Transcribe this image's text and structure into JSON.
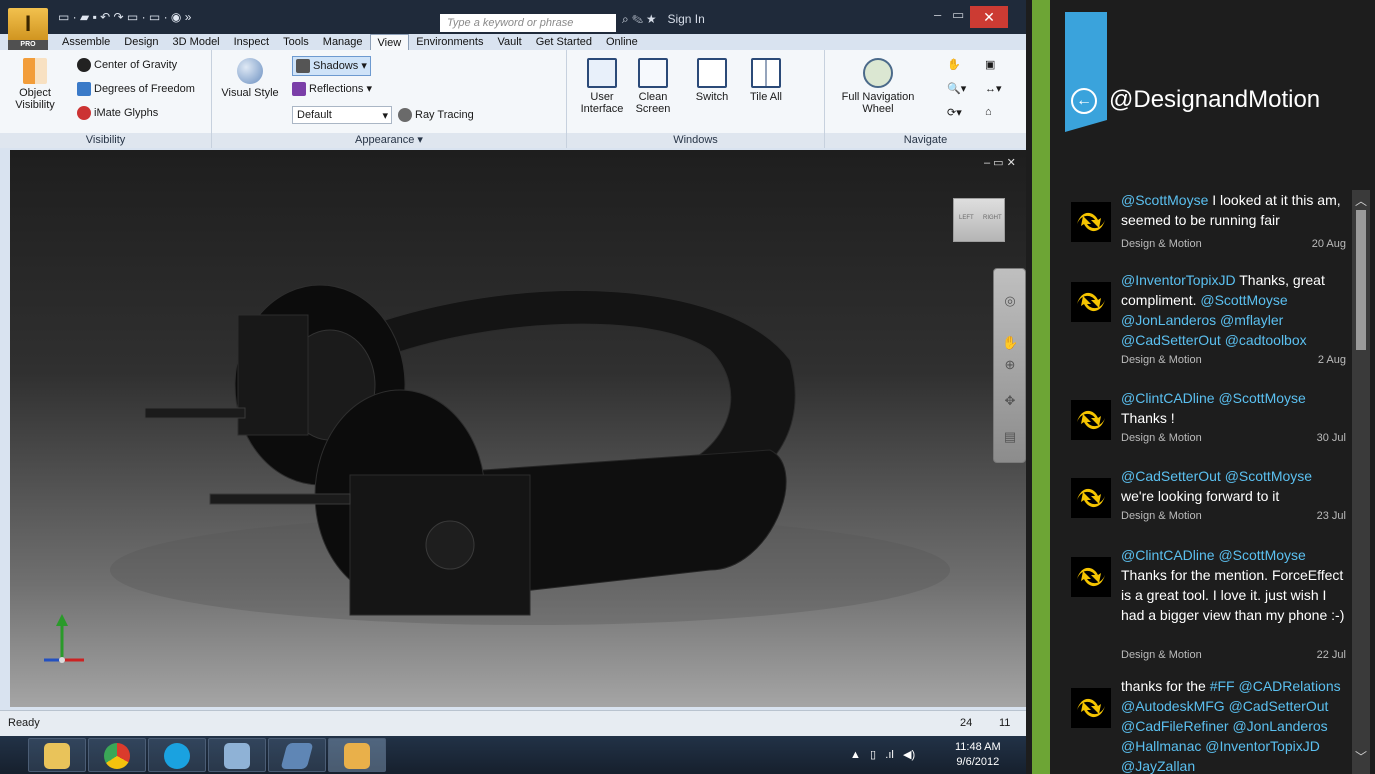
{
  "app": {
    "quick_access": "▭ · ▰ ▪ ↶ ↷ ▭ · ▭ · ◉ »",
    "search_placeholder": "Type a keyword or phrase",
    "sign_in": "Sign In",
    "tabs": [
      {
        "label": "Assemble"
      },
      {
        "label": "Design"
      },
      {
        "label": "3D Model"
      },
      {
        "label": "Inspect"
      },
      {
        "label": "Tools"
      },
      {
        "label": "Manage"
      },
      {
        "label": "View"
      },
      {
        "label": "Environments"
      },
      {
        "label": "Vault"
      },
      {
        "label": "Get Started"
      },
      {
        "label": "Online"
      }
    ],
    "active_tab": "View",
    "ribbon": {
      "visibility": {
        "object_visibility": "Object Visibility",
        "center_of_gravity": "Center of Gravity",
        "degrees_of_freedom": "Degrees of Freedom",
        "imate_glyphs": "iMate Glyphs",
        "label": "Visibility"
      },
      "appearance": {
        "visual_style": "Visual Style",
        "shadows": "Shadows",
        "reflections": "Reflections",
        "default": "Default",
        "ray_tracing": "Ray Tracing",
        "label": "Appearance ▾"
      },
      "windows": {
        "user_interface": "User Interface",
        "clean_screen": "Clean Screen",
        "switch": "Switch",
        "tile_all": "Tile All",
        "label": "Windows"
      },
      "navigate": {
        "full_nav_wheel": "Full Navigation Wheel",
        "label": "Navigate"
      }
    },
    "viewcube": {
      "left": "LEFT",
      "right": "RIGHT"
    },
    "status": {
      "text": "Ready",
      "count_a": "24",
      "count_b": "11"
    },
    "clock": {
      "time": "11:48 AM",
      "date": "9/6/2012"
    }
  },
  "sidebar": {
    "handle": "@DesignandMotion",
    "tweets": [
      {
        "mention": "@ScottMoyse",
        "body": " I looked at it this am, seemed to be running fair",
        "author": "Design & Motion",
        "date": "20 Aug"
      },
      {
        "mention": "@InventorTopixJD",
        "body": " Thanks, great compliment. ",
        "tail_mentions": "@ScottMoyse @JonLanderos @mflayler @CadSetterOut @cadtoolbox",
        "author": "Design & Motion",
        "date": "2 Aug"
      },
      {
        "mention": "@ClintCADline @ScottMoyse",
        "body": " Thanks !",
        "author": "Design & Motion",
        "date": "30 Jul"
      },
      {
        "mention": "@CadSetterOut @ScottMoyse",
        "body": " we're looking forward to it",
        "author": "Design & Motion",
        "date": "23 Jul"
      },
      {
        "mention": "@ClintCADline @ScottMoyse",
        "body": " Thanks for the mention. ForceEffect is a great tool. I love it. just wish I had a bigger view than my phone :-)",
        "author": "Design & Motion",
        "date": "22 Jul"
      },
      {
        "lead": "thanks for the ",
        "mention": "#FF @CADRelations @AutodeskMFG @CadSetterOut @CadFileRefiner @JonLanderos @Hallmanac @InventorTopixJD @JayZallan"
      }
    ]
  },
  "colors": {
    "twitter_blue": "#3aa3dc",
    "accent_green": "#6da535",
    "mention": "#5bc0f0"
  }
}
